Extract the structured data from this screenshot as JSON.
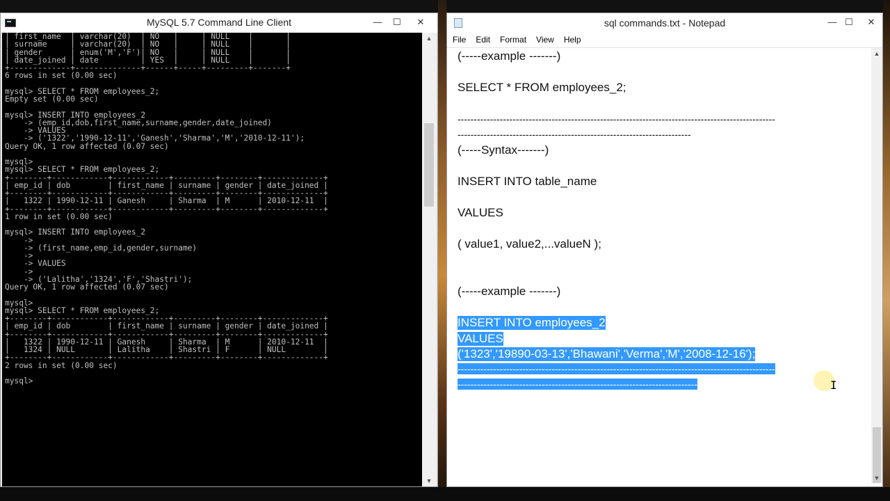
{
  "console": {
    "title": "MySQL 5.7 Command Line Client",
    "output": "| first_name  | varchar(20)  | NO   |     | NULL    |       |\n| surname     | varchar(20)  | NO   |     | NULL    |       |\n| gender      | enum('M','F')| NO   |     | NULL    |       |\n| date_joined | date         | YES  |     | NULL    |       |\n+-------------+--------------+------+-----+---------+-------+\n6 rows in set (0.00 sec)\n\nmysql> SELECT * FROM employees_2;\nEmpty set (0.00 sec)\n\nmysql> INSERT INTO employees_2\n    -> (emp_id,dob,first_name,surname,gender,date_joined)\n    -> VALUES\n    -> ('1322','1990-12-11','Ganesh','Sharma','M','2010-12-11');\nQuery OK, 1 row affected (0.07 sec)\n\nmysql>\nmysql> SELECT * FROM employees_2;\n+--------+------------+------------+---------+--------+-------------+\n| emp_id | dob        | first_name | surname | gender | date_joined |\n+--------+------------+------------+---------+--------+-------------+\n|   1322 | 1990-12-11 | Ganesh     | Sharma  | M      | 2010-12-11  |\n+--------+------------+------------+---------+--------+-------------+\n1 row in set (0.00 sec)\n\nmysql> INSERT INTO employees_2\n    ->\n    -> (first_name,emp_id,gender,surname)\n    ->\n    -> VALUES\n    ->\n    -> ('Lalitha','1324','F','Shastri');\nQuery OK, 1 row affected (0.07 sec)\n\nmysql>\nmysql> SELECT * FROM employees_2;\n+--------+------------+------------+---------+--------+-------------+\n| emp_id | dob        | first_name | surname | gender | date_joined |\n+--------+------------+------------+---------+--------+-------------+\n|   1322 | 1990-12-11 | Ganesh     | Sharma  | M      | 2010-12-11  |\n|   1324 | NULL       | Lalitha    | Shastri | F      | NULL        |\n+--------+------------+------------+---------+--------+-------------+\n2 rows in set (0.00 sec)\n\nmysql>"
  },
  "notepad": {
    "title": "sql commands.txt - Notepad",
    "menu": [
      "File",
      "Edit",
      "Format",
      "View",
      "Help"
    ],
    "lines": {
      "l1": "(-----example -------)",
      "l2": "SELECT * FROM employees_2;",
      "l3": "--------------------------------------------------------------------------------------------------",
      "l4": "------------------------------------------------------------------------",
      "l5": "(-----Syntax-------)",
      "l6": "INSERT INTO table_name",
      "l7": "VALUES",
      "l8": "( value1, value2,...valueN );",
      "l9": "(-----example -------)",
      "l10": "INSERT INTO employees_2",
      "l11": "VALUES",
      "l12": "('1323','19890-03-13','Bhawani','Verma','M','2008-12-16');",
      "l13": "--------------------------------------------------------------------------------------------------",
      "l14": "--------------------------------------------------------------------------"
    }
  },
  "window_buttons": {
    "minimize": "—",
    "maximize": "☐",
    "close": "✕"
  },
  "scroll_glyphs": {
    "up": "▲",
    "down": "▼"
  }
}
